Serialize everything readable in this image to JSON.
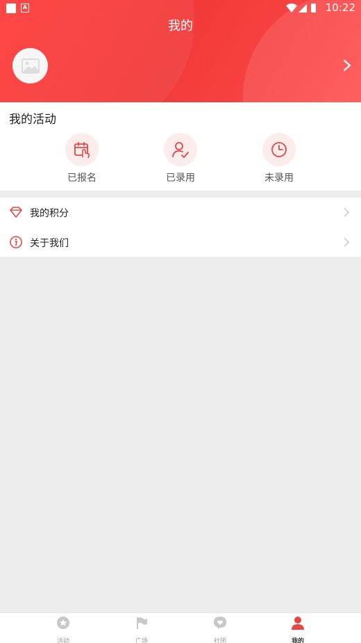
{
  "status_bar": {
    "time": "10:22"
  },
  "header": {
    "title": "我的"
  },
  "activities": {
    "title": "我的活动",
    "items": [
      {
        "label": "已报名",
        "icon": "calendar-touch-icon"
      },
      {
        "label": "已录用",
        "icon": "user-check-icon"
      },
      {
        "label": "未录用",
        "icon": "clock-icon"
      }
    ]
  },
  "menu": {
    "items": [
      {
        "label": "我的积分",
        "icon": "diamond-icon"
      },
      {
        "label": "关于我们",
        "icon": "info-icon"
      }
    ]
  },
  "tabbar": {
    "items": [
      {
        "label": "活动",
        "icon": "star-icon"
      },
      {
        "label": "广场",
        "icon": "flag-icon"
      },
      {
        "label": "社团",
        "icon": "chat-bubble-icon"
      },
      {
        "label": "我的",
        "icon": "person-icon"
      }
    ],
    "active": "我的"
  },
  "colors": {
    "accent": "#f23a3a",
    "background": "#ededed",
    "inactive_tab": "#bbbbbb"
  }
}
